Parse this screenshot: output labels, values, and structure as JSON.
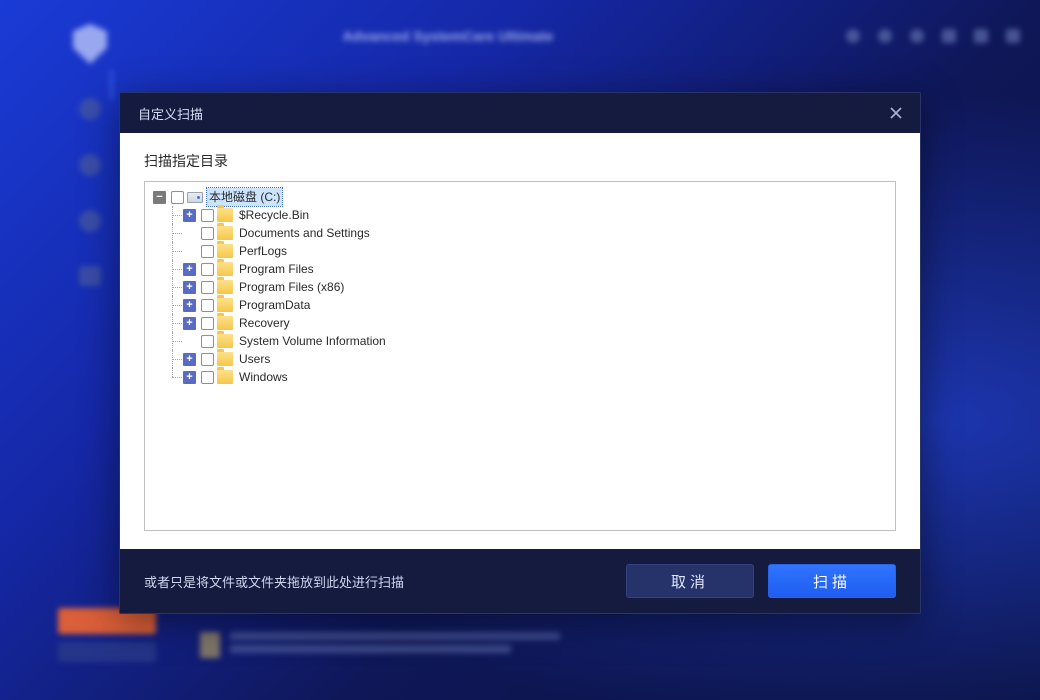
{
  "modal": {
    "title": "自定义扫描",
    "body_label": "扫描指定目录",
    "drag_hint": "或者只是将文件或文件夹拖放到此处进行扫描",
    "cancel_label": "取消",
    "scan_label": "扫描"
  },
  "tree": {
    "root": {
      "label": "本地磁盘 (C:)",
      "icon": "drive",
      "expanded": true,
      "selected": true,
      "children": [
        {
          "label": "$Recycle.Bin",
          "icon": "folder",
          "expandable": true
        },
        {
          "label": "Documents and Settings",
          "icon": "folder",
          "expandable": false
        },
        {
          "label": "PerfLogs",
          "icon": "folder",
          "expandable": false
        },
        {
          "label": "Program Files",
          "icon": "folder",
          "expandable": true
        },
        {
          "label": "Program Files (x86)",
          "icon": "folder",
          "expandable": true
        },
        {
          "label": "ProgramData",
          "icon": "folder",
          "expandable": true
        },
        {
          "label": "Recovery",
          "icon": "folder",
          "expandable": true
        },
        {
          "label": "System Volume Information",
          "icon": "folder",
          "expandable": false
        },
        {
          "label": "Users",
          "icon": "folder",
          "expandable": true
        },
        {
          "label": "Windows",
          "icon": "folder",
          "expandable": true
        }
      ]
    }
  }
}
